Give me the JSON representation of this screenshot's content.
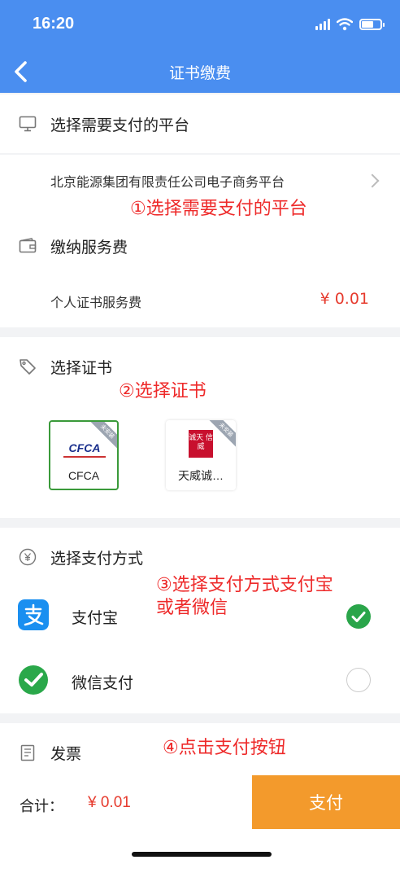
{
  "status_bar": {
    "time": "16:20"
  },
  "nav": {
    "title": "证书缴费"
  },
  "platform_section": {
    "title": "选择需要支付的平台",
    "selected_platform": "北京能源集团有限责任公司电子商务平台"
  },
  "fee_section": {
    "title": "缴纳服务费",
    "item_label": "个人证书服务费",
    "item_price": "¥ 0.01"
  },
  "cert_section": {
    "title": "选择证书",
    "certs": [
      {
        "label": "CFCA",
        "logo_text": "CFCA",
        "corner": "未安装",
        "selected": true
      },
      {
        "label": "天威诚…",
        "logo_text": "诚天 信威",
        "corner": "未安装",
        "selected": false
      }
    ]
  },
  "payment_section": {
    "title": "选择支付方式",
    "methods": [
      {
        "label": "支付宝",
        "icon": "alipay-icon",
        "selected": true
      },
      {
        "label": "微信支付",
        "icon": "wechat-pay-icon",
        "selected": false
      }
    ]
  },
  "invoice_section": {
    "title": "发票"
  },
  "annotations": {
    "step1": "①选择需要支付的平台",
    "step2": "②选择证书",
    "step3_line1": "③选择支付方式支付宝",
    "step3_line2": "或者微信",
    "step4": "④点击支付按钮"
  },
  "footer": {
    "total_label": "合计：",
    "total_amount": "¥ 0.01",
    "pay_button": "支付"
  },
  "colors": {
    "primary_blue": "#4a8ef0",
    "price_red": "#e63b2e",
    "annotation_red": "#ee2a2a",
    "pay_orange": "#f39a2c",
    "selected_green": "#2aa54a"
  }
}
